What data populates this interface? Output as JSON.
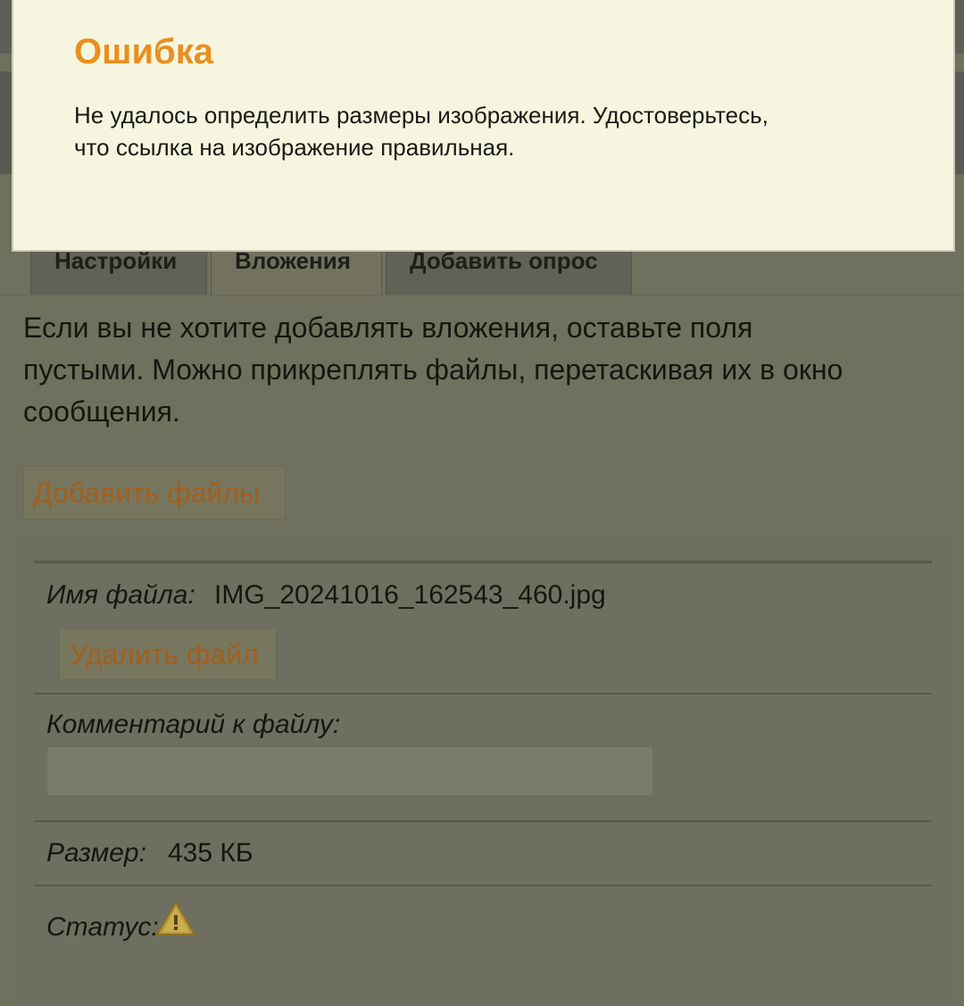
{
  "dialog": {
    "title": "Ошибка",
    "message_line1": "Не удалось определить размеры изображения. Удостоверьтесь,",
    "message_line2": "что ссылка на изображение правильная."
  },
  "tabs": [
    {
      "label": "Настройки",
      "active": false
    },
    {
      "label": "Вложения",
      "active": true
    },
    {
      "label": "Добавить опрос",
      "active": false
    }
  ],
  "attachments": {
    "intro_line1": "Если вы не хотите добавлять вложения, оставьте поля",
    "intro_line2": "пустыми. Можно прикреплять файлы, перетаскивая их в окно",
    "intro_line3": "сообщения.",
    "add_files_label": "Добавить файлы",
    "file": {
      "name_label": "Имя файла:",
      "name_value": "IMG_20241016_162543_460.jpg",
      "delete_label": "Удалить файл",
      "comment_label": "Комментарий к файлу:",
      "comment_value": "",
      "size_label": "Размер:",
      "size_value": "435 КБ",
      "status_label": "Статус:",
      "status_icon": "warning-icon"
    }
  },
  "colors": {
    "dialog_title": "#e7901f",
    "link_button_text": "#a45e1c",
    "dialog_background": "#f6f6e0"
  }
}
